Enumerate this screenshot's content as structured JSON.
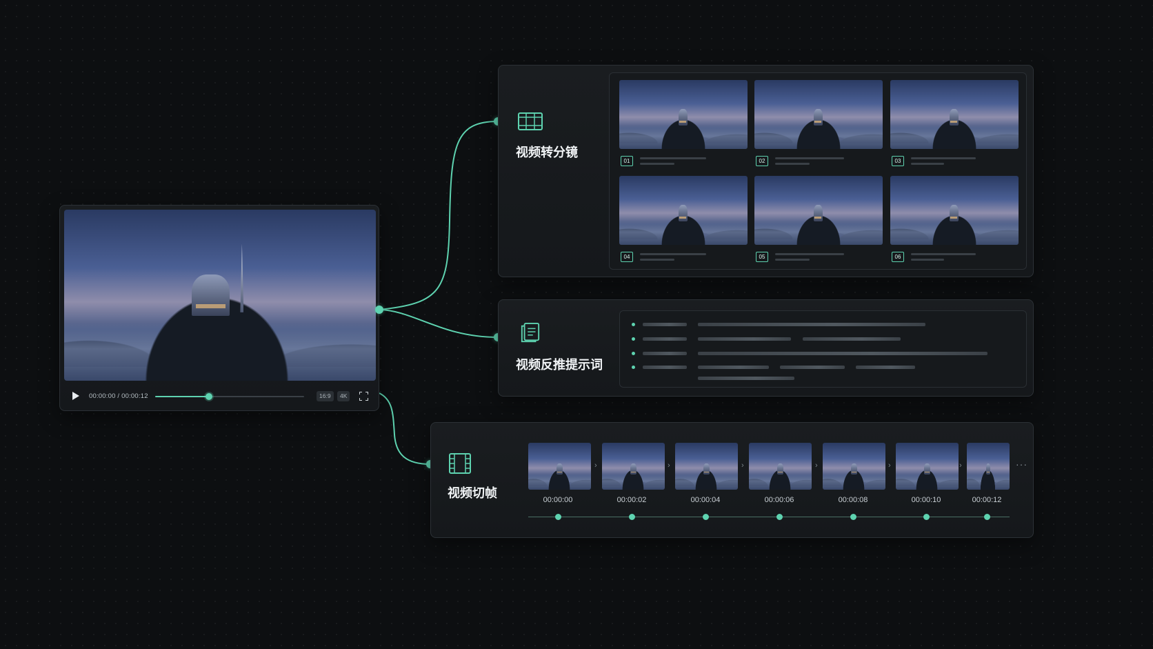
{
  "colors": {
    "accent": "#5ed3b0",
    "background": "#0d0f11",
    "panel": "#1a1d20"
  },
  "player": {
    "timecode": "00:00:00 / 00:00:12",
    "progress": 0.36,
    "aspect_ratio": "16:9",
    "resolution": "4K",
    "icons": {
      "play": "play-icon",
      "fullscreen": "fullscreen-icon"
    }
  },
  "storyboard": {
    "title": "视频转分镜",
    "icon": "film-strip-icon",
    "shots": [
      "01",
      "02",
      "03",
      "04",
      "05",
      "06"
    ]
  },
  "prompt": {
    "title": "视频反推提示词",
    "icon": "document-icon"
  },
  "frames": {
    "title": "视频切帧",
    "icon": "film-frames-icon",
    "timestamps": [
      "00:00:00",
      "00:00:02",
      "00:00:04",
      "00:00:06",
      "00:00:08",
      "00:00:10",
      "00:00:12"
    ],
    "more_icon": "more-icon"
  }
}
